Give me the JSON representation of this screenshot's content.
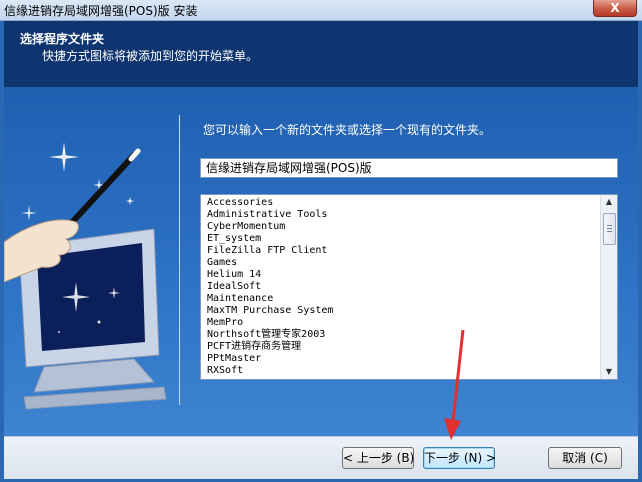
{
  "window": {
    "title": "信缘进销存局域网增强(POS)版 安装",
    "close_label": "X"
  },
  "header": {
    "title": "选择程序文件夹",
    "subtitle": "快捷方式图标将被添加到您的开始菜单。"
  },
  "main": {
    "prompt": "您可以输入一个新的文件夹或选择一个现有的文件夹。",
    "folder_value": "信缘进销存局域网增强(POS)版",
    "folders": [
      "Accessories",
      "Administrative Tools",
      "CyberMomentum",
      "ET_system",
      "FileZilla FTP Client",
      "Games",
      "Helium 14",
      "IdealSoft",
      "Maintenance",
      "MaxTM Purchase System",
      "MemPro",
      "Northsoft管理专家2003",
      "PCFT进销存商务管理",
      "PPtMaster",
      "RXSoft"
    ]
  },
  "footer": {
    "back_label": "< 上一步 (B)",
    "next_label": "下一步 (N) >",
    "cancel_label": "取消 (C)"
  },
  "colors": {
    "header_bg": "#0f3570",
    "body_bg": "#2a68b4",
    "annotation_arrow": "#e03030"
  }
}
